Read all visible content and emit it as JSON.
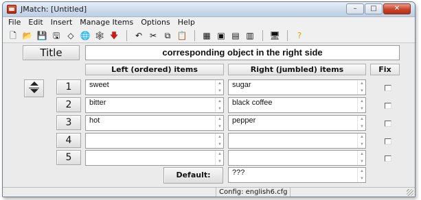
{
  "window": {
    "title": "JMatch: [Untitled]",
    "controls": {
      "minimize": "–",
      "maximize": "□",
      "close": "✕"
    }
  },
  "menu": [
    "File",
    "Edit",
    "Insert",
    "Manage Items",
    "Options",
    "Help"
  ],
  "toolbar": {
    "groups": [
      [
        {
          "name": "new-file-icon",
          "glyph": "🗋"
        },
        {
          "name": "open-folder-icon",
          "glyph": "📂"
        },
        {
          "name": "save-icon",
          "glyph": "💾"
        },
        {
          "name": "save-as-icon",
          "glyph": "🖫"
        },
        {
          "name": "diamond-icon",
          "glyph": "◇"
        },
        {
          "name": "export-web-icon",
          "glyph": "🌐"
        },
        {
          "name": "export-web-2-icon",
          "glyph": "🕸"
        },
        {
          "name": "red-arrow-down-icon",
          "glyph": "🡇",
          "color": "#c0201a"
        }
      ],
      [
        {
          "name": "undo-icon",
          "glyph": "↶"
        },
        {
          "name": "cut-icon",
          "glyph": "✂"
        },
        {
          "name": "copy-icon",
          "glyph": "⧉"
        },
        {
          "name": "paste-icon",
          "glyph": "📋"
        }
      ],
      [
        {
          "name": "tool-1-icon",
          "glyph": "▦"
        },
        {
          "name": "tool-2-icon",
          "glyph": "▣"
        },
        {
          "name": "tool-3-icon",
          "glyph": "▤"
        },
        {
          "name": "tool-4-icon",
          "glyph": "▥"
        }
      ],
      [
        {
          "name": "monitor-icon",
          "glyph": "🖥"
        }
      ],
      [
        {
          "name": "help-icon",
          "glyph": "?",
          "color": "#d8a400"
        }
      ]
    ]
  },
  "title_label": "Title",
  "title_value": "corresponding object in the right side",
  "headers": {
    "left": "Left (ordered) items",
    "right": "Right (jumbled) items",
    "fix": "Fix"
  },
  "rows": [
    {
      "num": "1",
      "left": "sweet",
      "right": "sugar",
      "fix": false
    },
    {
      "num": "2",
      "left": "bitter",
      "right": "black coffee",
      "fix": false
    },
    {
      "num": "3",
      "left": "hot",
      "right": "pepper",
      "fix": false
    },
    {
      "num": "4",
      "left": "",
      "right": "",
      "fix": false
    },
    {
      "num": "5",
      "left": "",
      "right": "",
      "fix": false
    }
  ],
  "default": {
    "label": "Default:",
    "value": "???"
  },
  "status": "Config: english6.cfg"
}
